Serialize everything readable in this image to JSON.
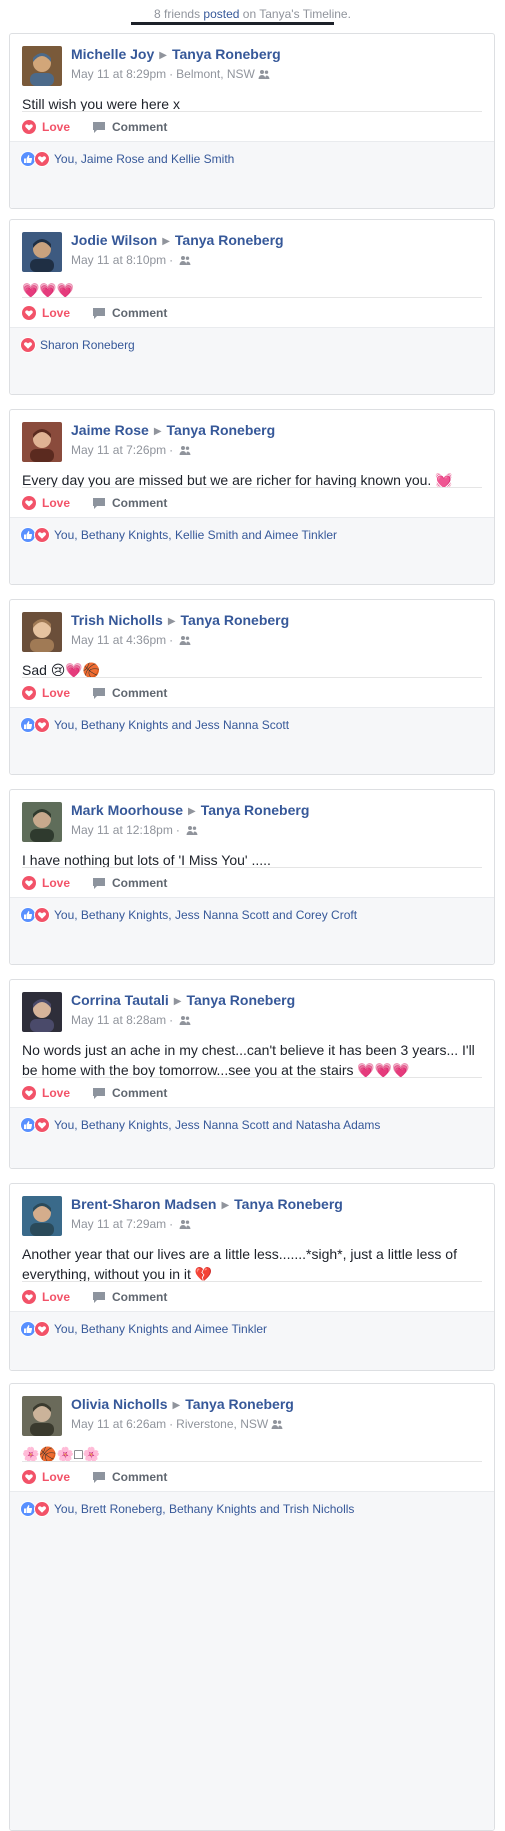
{
  "header": {
    "count_text": "8 friends",
    "posted_text": "posted",
    "rest_text": "on Tanya's Timeline."
  },
  "actions": {
    "love_label": "Love",
    "comment_label": "Comment"
  },
  "colors": {
    "link": "#365899",
    "love": "#f25268",
    "like": "#5890ff",
    "muted": "#90949c"
  },
  "posts": [
    {
      "author": "Michelle Joy",
      "target": "Tanya Roneberg",
      "time": "May 11 at 8:29pm",
      "location": "Belmont, NSW",
      "text": "Still wish you were here x",
      "reactions": [
        "like",
        "love"
      ],
      "reaction_names": "You, Jaime Rose and Kellie Smith"
    },
    {
      "author": "Jodie Wilson",
      "target": "Tanya Roneberg",
      "time": "May 11 at 8:10pm",
      "location": "",
      "text": "💗💗💗",
      "reactions": [
        "love"
      ],
      "reaction_names": "Sharon Roneberg"
    },
    {
      "author": "Jaime Rose",
      "target": "Tanya Roneberg",
      "time": "May 11 at 7:26pm",
      "location": "",
      "text": "Every day you are missed but we are richer for having known you. 💓",
      "reactions": [
        "like",
        "love"
      ],
      "reaction_names": "You, Bethany Knights, Kellie Smith and Aimee Tinkler"
    },
    {
      "author": "Trish Nicholls",
      "target": "Tanya Roneberg",
      "time": "May 11 at 4:36pm",
      "location": "",
      "text": "Sad 😢💗🏀",
      "reactions": [
        "like",
        "love"
      ],
      "reaction_names": "You, Bethany Knights and Jess Nanna Scott"
    },
    {
      "author": "Mark Moorhouse",
      "target": "Tanya Roneberg",
      "time": "May 11 at 12:18pm",
      "location": "",
      "text": "I have nothing but lots of 'I Miss You' .....",
      "reactions": [
        "like",
        "love"
      ],
      "reaction_names": "You, Bethany Knights, Jess Nanna Scott and Corey Croft"
    },
    {
      "author": "Corrina Tautali",
      "target": "Tanya Roneberg",
      "time": "May 11 at 8:28am",
      "location": "",
      "text": "No words just an ache in my chest...can't believe it has been 3 years... I'll be home with the boy tomorrow...see you at the stairs 💗💗💗",
      "reactions": [
        "like",
        "love"
      ],
      "reaction_names": "You, Bethany Knights, Jess Nanna Scott and Natasha Adams"
    },
    {
      "author": "Brent-Sharon Madsen",
      "target": "Tanya Roneberg",
      "time": "May 11 at 7:29am",
      "location": "",
      "text": "Another year that our lives are a little less.......*sigh*, just a little less of everything, without you in it 💔",
      "reactions": [
        "like",
        "love"
      ],
      "reaction_names": "You, Bethany Knights and Aimee Tinkler"
    },
    {
      "author": "Olivia Nicholls",
      "target": "Tanya Roneberg",
      "time": "May 11 at 6:26am",
      "location": "Riverstone, NSW",
      "text": "🌸🏀🌸□🌸",
      "reactions": [
        "like",
        "love"
      ],
      "reaction_names": "You, Brett Roneberg, Bethany Knights and Trish Nicholls"
    }
  ]
}
